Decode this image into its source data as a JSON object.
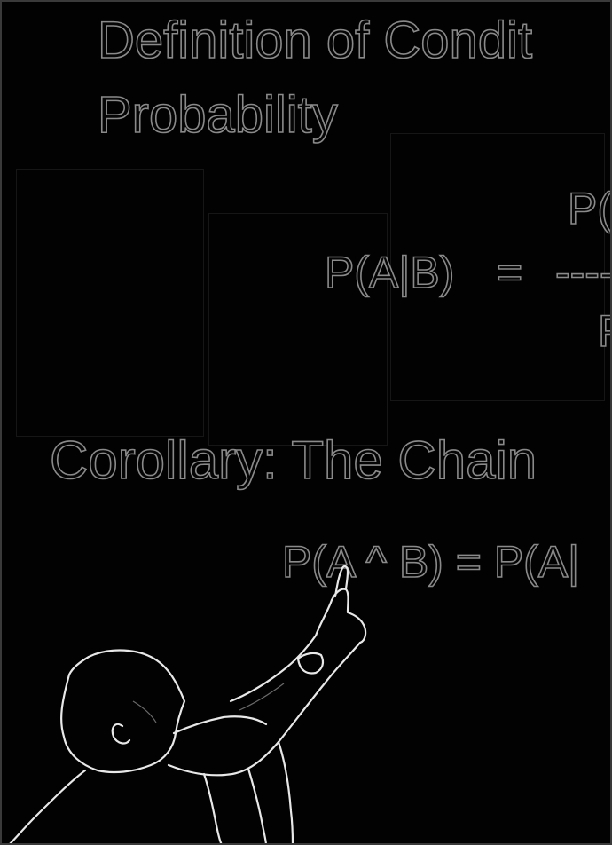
{
  "slide": {
    "title_line_1": "Definition of Condit",
    "title_line_2": "Probability",
    "formula": {
      "numerator": "P(",
      "lhs": "P(A|B)",
      "equals": "=",
      "fraction_bar": "----",
      "denominator": "P"
    },
    "corollary": "Corollary: The Chain",
    "chain_rule": "P(A ^ B) = P(A|"
  },
  "colors": {
    "background": "#020202",
    "outline": "#8a8a8a",
    "figure_outline": "#e8e8e8"
  },
  "presenter": {
    "description_icon": "person-pointing-icon"
  }
}
